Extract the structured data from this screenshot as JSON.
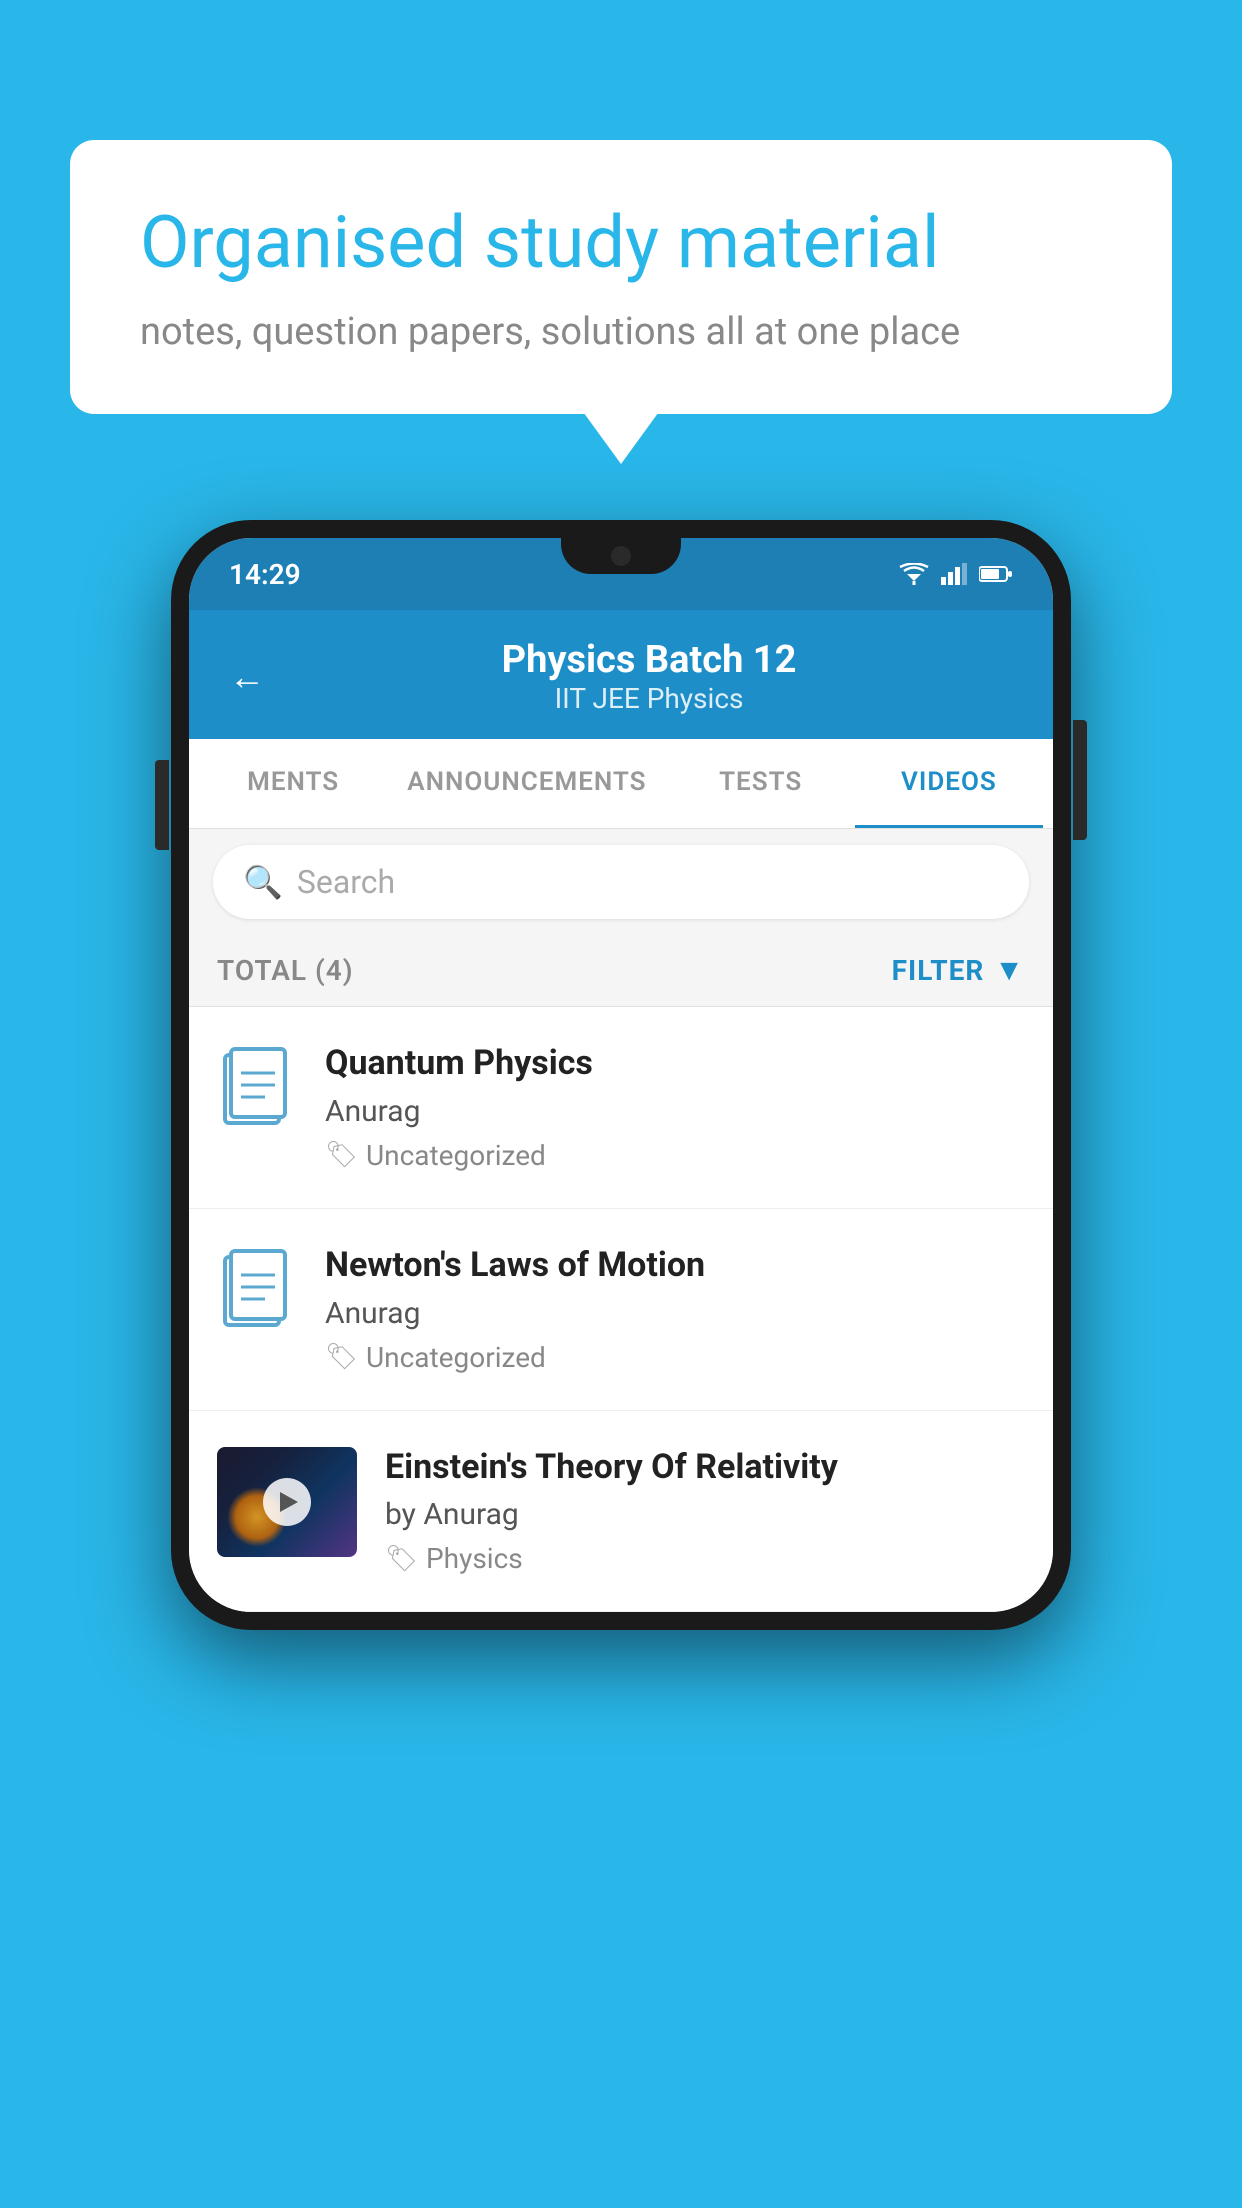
{
  "background": {
    "color": "#29b6e8"
  },
  "speech_bubble": {
    "heading": "Organised study material",
    "subtext": "notes, question papers, solutions all at one place"
  },
  "phone": {
    "status_bar": {
      "time": "14:29"
    },
    "header": {
      "back_label": "←",
      "title": "Physics Batch 12",
      "subtitle": "IIT JEE   Physics"
    },
    "tabs": [
      {
        "label": "MENTS",
        "active": false
      },
      {
        "label": "ANNOUNCEMENTS",
        "active": false
      },
      {
        "label": "TESTS",
        "active": false
      },
      {
        "label": "VIDEOS",
        "active": true
      }
    ],
    "search": {
      "placeholder": "Search"
    },
    "filter_bar": {
      "total_label": "TOTAL (4)",
      "filter_label": "FILTER"
    },
    "videos": [
      {
        "id": 1,
        "title": "Quantum Physics",
        "author": "Anurag",
        "tag": "Uncategorized",
        "has_thumbnail": false
      },
      {
        "id": 2,
        "title": "Newton's Laws of Motion",
        "author": "Anurag",
        "tag": "Uncategorized",
        "has_thumbnail": false
      },
      {
        "id": 3,
        "title": "Einstein's Theory Of Relativity",
        "author": "by Anurag",
        "tag": "Physics",
        "has_thumbnail": true
      }
    ]
  }
}
